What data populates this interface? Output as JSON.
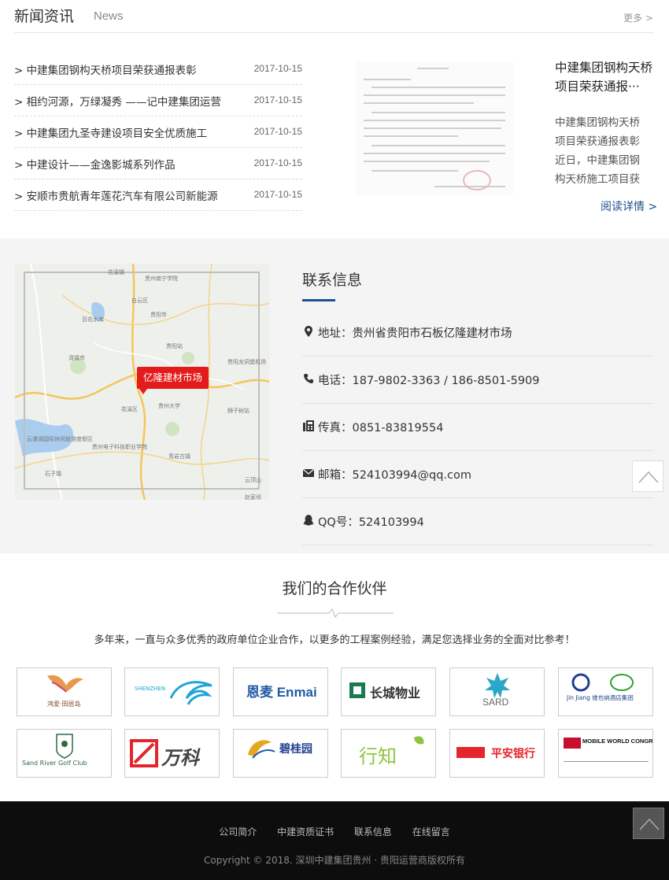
{
  "news": {
    "title": "新闻资讯",
    "subtitle": "News",
    "more": "更多 >",
    "items": [
      {
        "title": "> 中建集团钢构天桥项目荣获通报表彰",
        "date": "2017-10-15"
      },
      {
        "title": "> 相约河源，万绿凝秀 ——记中建集团运营",
        "date": "2017-10-15"
      },
      {
        "title": "> 中建集团九圣寺建设项目安全优质施工",
        "date": "2017-10-15"
      },
      {
        "title": "> 中建设计——金逸影城系列作品",
        "date": "2017-10-15"
      },
      {
        "title": "> 安顺市贵航青年莲花汽车有限公司新能源",
        "date": "2017-10-15"
      }
    ],
    "featured": {
      "title": "中建集团钢构天桥项目荣获通报···",
      "desc": "中建集团钢构天桥项目荣获通报表彰近日，中建集团钢构天桥施工项目获",
      "more": "阅读详情 >"
    }
  },
  "contact": {
    "title": "联系信息",
    "map_marker": "亿隆建材市场",
    "rows": [
      {
        "icon": "map-marker-icon",
        "text": "地址：贵州省贵阳市石板亿隆建材市场"
      },
      {
        "icon": "phone-icon",
        "text": "电话：187-9802-3363 / 186-8501-5909"
      },
      {
        "icon": "fax-icon",
        "text": "传真：0851-83819554"
      },
      {
        "icon": "envelope-icon",
        "text": "邮箱：524103994@qq.com"
      },
      {
        "icon": "qq-icon",
        "text": "QQ号：524103994"
      }
    ]
  },
  "partners": {
    "title": "我们的合作伙伴",
    "subtitle": "多年来，一直与众多优秀的政府单位企业合作，以更多的工程案例经验，满足您选择业务的全面对比参考！",
    "logos": [
      {
        "name": "鸿爱·田居岛"
      },
      {
        "name": "SHENZHEN"
      },
      {
        "name": "恩麦 Enmai"
      },
      {
        "name": "长城物业"
      },
      {
        "name": "SARD"
      },
      {
        "name": "Jin Jiang 维也纳酒店集团"
      },
      {
        "name": "Sand River Golf Club"
      },
      {
        "name": "万科"
      },
      {
        "name": "碧桂园"
      },
      {
        "name": "行知"
      },
      {
        "name": "平安银行"
      },
      {
        "name": "MOBILE WORLD CONGRESS"
      }
    ]
  },
  "footer": {
    "nav": [
      "公司简介",
      "中建资质证书",
      "联系信息",
      "在线留言"
    ],
    "copyright": "Copyright © 2018. 深圳中建集团贵州 · 贵阳运营商版权所有"
  },
  "colors": {
    "accent": "#1c4f8e",
    "marker": "#e31b1b",
    "footer_bg": "#0d0d0d"
  }
}
